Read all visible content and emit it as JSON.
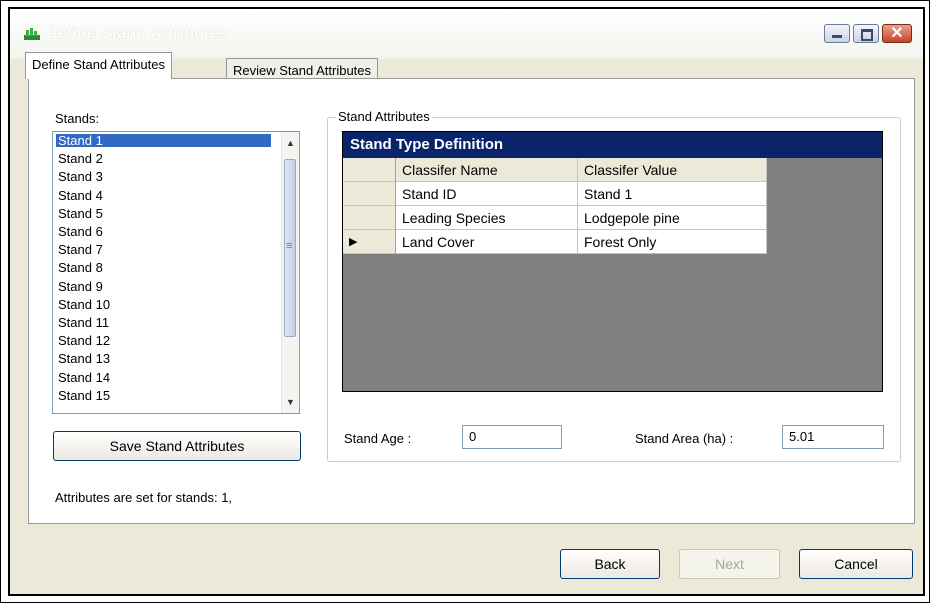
{
  "window": {
    "title": "Define Stand Attributes",
    "caption_close_glyph": "✕"
  },
  "tabs": [
    {
      "label": "Define Stand Attributes",
      "active": true
    },
    {
      "label": "Review Stand Attributes",
      "active": false
    }
  ],
  "stands_panel": {
    "label": "Stands:",
    "items": [
      "Stand 1",
      "Stand 2",
      "Stand 3",
      "Stand 4",
      "Stand 5",
      "Stand 6",
      "Stand 7",
      "Stand 8",
      "Stand 9",
      "Stand 10",
      "Stand 11",
      "Stand 12",
      "Stand 13",
      "Stand 14",
      "Stand 15"
    ],
    "selected": "Stand 1",
    "save_label": "Save Stand Attributes",
    "status_text": "Attributes are set for stands: 1,"
  },
  "attributes_group": {
    "title": "Stand Attributes",
    "grid": {
      "title": "Stand Type Definition",
      "columns": [
        "Classifer Name",
        "Classifer Value"
      ],
      "rows": [
        {
          "name": "Stand ID",
          "value": "Stand 1",
          "current": false
        },
        {
          "name": "Leading Species",
          "value": "Lodgepole pine",
          "current": false
        },
        {
          "name": "Land Cover",
          "value": "Forest Only",
          "current": true
        }
      ],
      "current_row_glyph": "▶"
    },
    "stand_age_label": "Stand Age :",
    "stand_age_value": "0",
    "stand_area_label": "Stand Area (ha) :",
    "stand_area_value": "5.01"
  },
  "footer": {
    "back_label": "Back",
    "next_label": "Next",
    "cancel_label": "Cancel"
  },
  "colors": {
    "selection": "#316ac5",
    "grid_title_bg": "#0a246a",
    "grid_bg": "#808080",
    "dialog_bg": "#ece9d8"
  },
  "scroll": {
    "up_glyph": "▲",
    "down_glyph": "▼",
    "grip_glyph": "≡"
  }
}
